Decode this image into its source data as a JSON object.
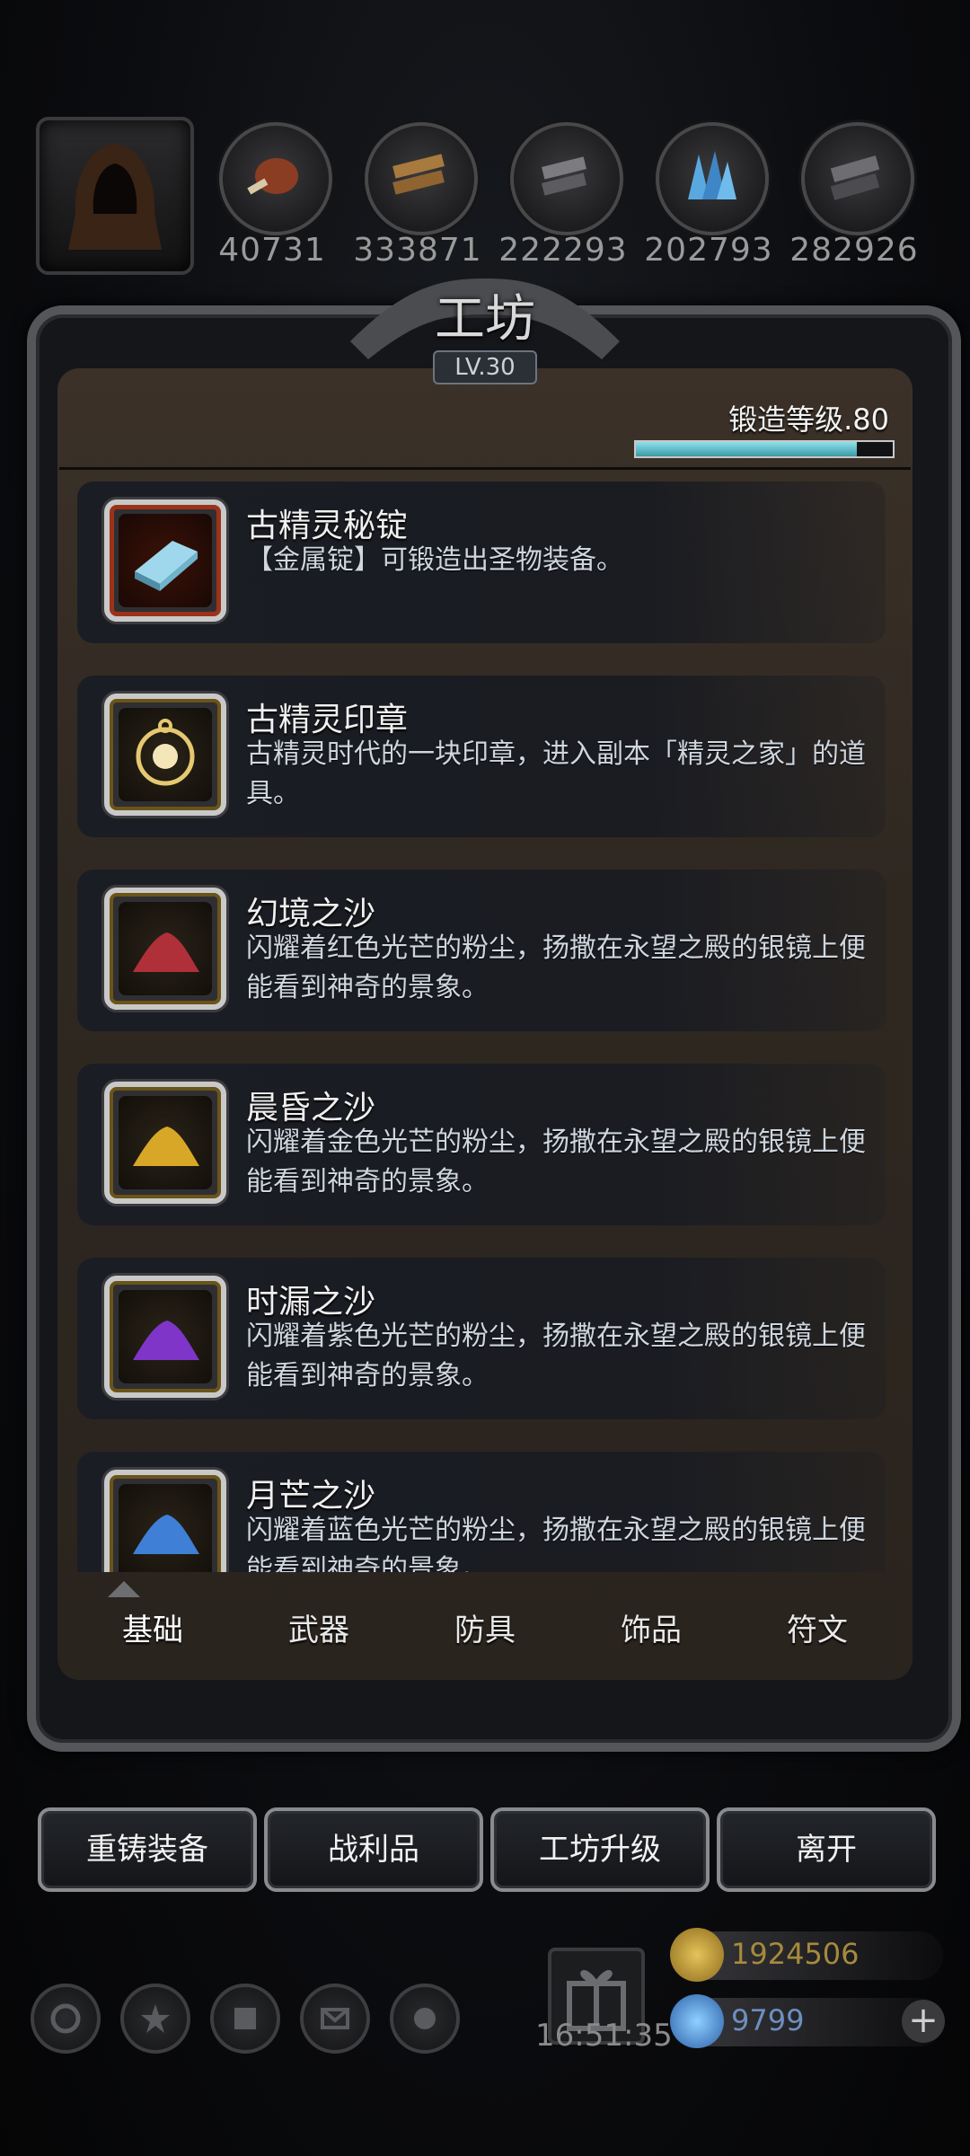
{
  "resources": {
    "values": [
      "40731",
      "333871",
      "222293",
      "202793",
      "282926"
    ]
  },
  "workshop": {
    "title": "工坊",
    "level": "LV.30",
    "forge_label": "锻造等级.80",
    "forge_progress": 0.86
  },
  "items": [
    {
      "name": "古精灵秘锭",
      "desc": "【金属锭】可锻造出圣物装备。",
      "icon": "ingot-icon"
    },
    {
      "name": "古精灵印章",
      "desc": "古精灵时代的一块印章，进入副本「精灵之家」的道具。",
      "icon": "seal-icon"
    },
    {
      "name": "幻境之沙",
      "desc": "闪耀着红色光芒的粉尘，扬撒在永望之殿的银镜上便能看到神奇的景象。",
      "icon": "red-sand-icon"
    },
    {
      "name": "晨昏之沙",
      "desc": "闪耀着金色光芒的粉尘，扬撒在永望之殿的银镜上便能看到神奇的景象。",
      "icon": "gold-sand-icon"
    },
    {
      "name": "时漏之沙",
      "desc": "闪耀着紫色光芒的粉尘，扬撒在永望之殿的银镜上便能看到神奇的景象。",
      "icon": "purple-sand-icon"
    },
    {
      "name": "月芒之沙",
      "desc": "闪耀着蓝色光芒的粉尘，扬撒在永望之殿的银镜上便能看到神奇的景象。",
      "icon": "blue-sand-icon"
    }
  ],
  "tabs": [
    "基础",
    "武器",
    "防具",
    "饰品",
    "符文"
  ],
  "actions": [
    "重铸装备",
    "战利品",
    "工坊升级",
    "离开"
  ],
  "bottom": {
    "time": "16:51:35",
    "gold": "1924506",
    "gems": "9799"
  }
}
